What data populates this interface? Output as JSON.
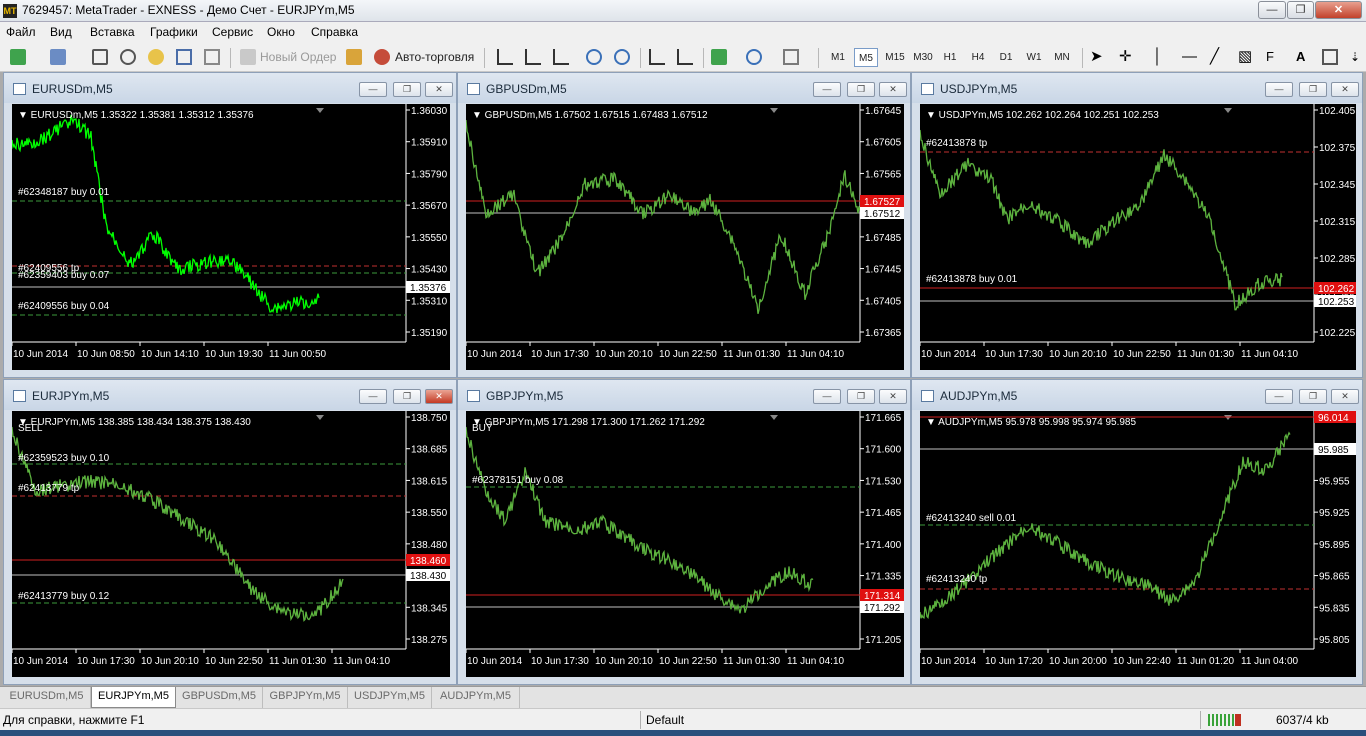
{
  "window": {
    "title": "7629457: MetaTrader - EXNESS - Демо Счет - EURJPYm,M5",
    "logo": "MT"
  },
  "menu": [
    "Файл",
    "Вид",
    "Вставка",
    "Графики",
    "Сервис",
    "Окно",
    "Справка"
  ],
  "toolbar": {
    "new_order": "Новый Ордер",
    "autotrading": "Авто-торговля",
    "timeframes": [
      "M1",
      "M5",
      "M15",
      "M30",
      "H1",
      "H4",
      "D1",
      "W1",
      "MN"
    ],
    "active_timeframe": "M5",
    "text_tool": "A"
  },
  "charts": [
    {
      "title": "EURUSDm,M5",
      "info": "EURUSDm,M5  1.35322 1.35381 1.35312 1.35376",
      "prices": [
        "1.36030",
        "1.35910",
        "1.35790",
        "1.35670",
        "1.35550",
        "1.35430",
        "1.35310",
        "1.35190"
      ],
      "current_price": "1.35376",
      "times": [
        "10 Jun 2014",
        "10 Jun 08:50",
        "10 Jun 14:10",
        "10 Jun 19:30",
        "11 Jun 00:50"
      ],
      "labels": [
        "#62348187 buy 0.01",
        "#62409556 tp",
        "#62359403 buy 0.07",
        "#62409556 buy 0.04"
      ],
      "color": "#00ff00"
    },
    {
      "title": "GBPUSDm,M5",
      "info": "GBPUSDm,M5  1.67502 1.67515 1.67483 1.67512",
      "prices": [
        "1.67645",
        "1.67605",
        "1.67565",
        "1.67525",
        "1.67485",
        "1.67445",
        "1.67405",
        "1.67365"
      ],
      "current_price": "1.67512",
      "red_price": "1.67527",
      "times": [
        "10 Jun 2014",
        "10 Jun 17:30",
        "10 Jun 20:10",
        "10 Jun 22:50",
        "11 Jun 01:30",
        "11 Jun 04:10"
      ],
      "labels": [],
      "color": "#5db33f"
    },
    {
      "title": "USDJPYm,M5",
      "info": "USDJPYm,M5  102.262 102.264 102.251 102.253",
      "prices": [
        "102.405",
        "102.375",
        "102.345",
        "102.315",
        "102.285",
        "102.255",
        "102.225"
      ],
      "current_price": "102.253",
      "red_price": "102.262",
      "times": [
        "10 Jun 2014",
        "10 Jun 17:30",
        "10 Jun 20:10",
        "10 Jun 22:50",
        "11 Jun 01:30",
        "11 Jun 04:10"
      ],
      "labels": [
        "#62413878 tp",
        "#62413878 buy 0.01"
      ],
      "color": "#5db33f"
    },
    {
      "title": "EURJPYm,M5",
      "info": "EURJPYm,M5  138.385 138.434 138.375 138.430",
      "prices": [
        "138.750",
        "138.685",
        "138.615",
        "138.550",
        "138.480",
        "138.415",
        "138.345",
        "138.275"
      ],
      "current_price": "138.430",
      "red_price": "138.460",
      "times": [
        "10 Jun 2014",
        "10 Jun 17:30",
        "10 Jun 20:10",
        "10 Jun 22:50",
        "11 Jun 01:30",
        "11 Jun 04:10"
      ],
      "labels": [
        "SELL",
        "#62359523 buy 0.10",
        "#62413779 tp",
        "#62413779 buy 0.12"
      ],
      "color": "#5db33f"
    },
    {
      "title": "GBPJPYm,M5",
      "info": "GBPJPYm,M5  171.298 171.300 171.262 171.292",
      "prices": [
        "171.665",
        "171.600",
        "171.530",
        "171.465",
        "171.400",
        "171.335",
        "171.270",
        "171.205"
      ],
      "current_price": "171.292",
      "red_price": "171.314",
      "times": [
        "10 Jun 2014",
        "10 Jun 17:30",
        "10 Jun 20:10",
        "10 Jun 22:50",
        "11 Jun 01:30",
        "11 Jun 04:10"
      ],
      "labels": [
        "BUY",
        "#62378151 buy 0.08"
      ],
      "color": "#5db33f"
    },
    {
      "title": "AUDJPYm,M5",
      "info": "AUDJPYm,M5  95.978 95.998 95.974 95.985",
      "prices": [
        "96.014",
        "95.985",
        "95.955",
        "95.925",
        "95.895",
        "95.865",
        "95.835",
        "95.805"
      ],
      "current_price": "95.985",
      "red_price": "96.014",
      "times": [
        "10 Jun 2014",
        "10 Jun 17:20",
        "10 Jun 20:00",
        "10 Jun 22:40",
        "11 Jun 01:20",
        "11 Jun 04:00"
      ],
      "labels": [
        "#62413240 sell 0.01",
        "#62413240 tp"
      ],
      "color": "#5db33f"
    }
  ],
  "tabs": [
    "EURUSDm,M5",
    "EURJPYm,M5",
    "GBPUSDm,M5",
    "GBPJPYm,M5",
    "USDJPYm,M5",
    "AUDJPYm,M5"
  ],
  "active_tab": "EURJPYm,M5",
  "status": {
    "help": "Для справки, нажмите F1",
    "profile": "Default",
    "traffic": "6037/4 kb"
  }
}
